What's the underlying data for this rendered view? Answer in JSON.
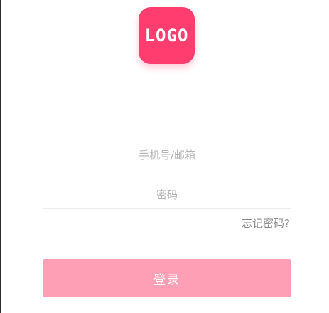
{
  "logo": {
    "text": "LOGO",
    "color": "#ff3d6e"
  },
  "form": {
    "account_placeholder": "手机号/邮箱",
    "account_value": "",
    "password_placeholder": "密码",
    "password_value": "",
    "forgot_label": "忘记密码?",
    "login_label": "登录"
  },
  "colors": {
    "accent": "#ff3d6e",
    "button": "#ff9fb5",
    "placeholder": "#b3b3b3",
    "divider": "#ededed"
  }
}
